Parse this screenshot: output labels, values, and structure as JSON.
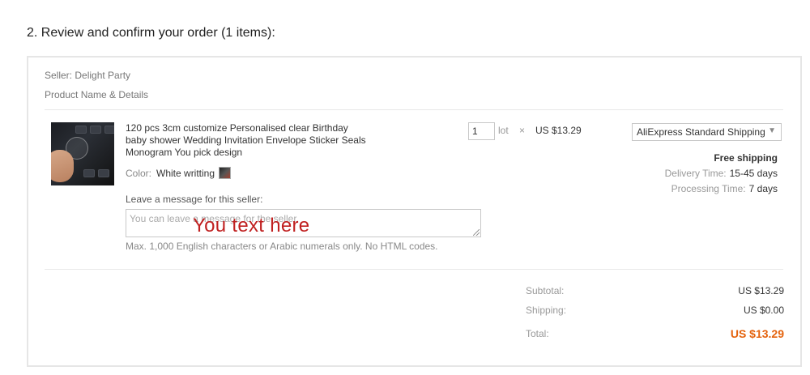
{
  "section_title": "2. Review and confirm your order (1 items):",
  "seller_line": "Seller: Delight Party",
  "column_header": "Product Name & Details",
  "product": {
    "name": "120 pcs 3cm customize Personalised clear Birthday baby shower Wedding Invitation Envelope Sticker Seals Monogram You pick design",
    "color_label": "Color:",
    "color_value": "White writting"
  },
  "message": {
    "label": "Leave a message for this seller:",
    "placeholder": "You can leave a message for the seller.",
    "overlay_text": "You text here",
    "hint": "Max. 1,000 English characters or Arabic numerals only. No HTML codes."
  },
  "quantity": {
    "value": "1",
    "unit": "lot",
    "times": "×",
    "unit_price": "US $13.29"
  },
  "shipping": {
    "method": "AliExpress Standard Shipping",
    "free_text": "Free shipping",
    "delivery_label": "Delivery Time:",
    "delivery_value": "15-45 days",
    "processing_label": "Processing Time:",
    "processing_value": "7 days"
  },
  "summary": {
    "subtotal_label": "Subtotal:",
    "subtotal_value": "US $13.29",
    "shipping_label": "Shipping:",
    "shipping_value": "US $0.00",
    "total_label": "Total:",
    "total_value": "US $13.29"
  },
  "colors": {
    "total_accent": "#e4620c",
    "overlay_red": "#c02020"
  }
}
